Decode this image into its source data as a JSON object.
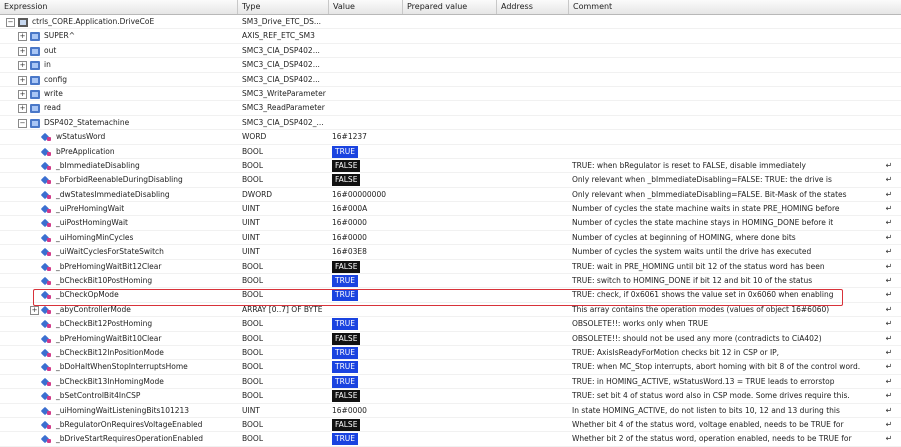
{
  "columns": {
    "expression": "Expression",
    "type": "Type",
    "value": "Value",
    "prepared": "Prepared value",
    "address": "Address",
    "comment": "Comment"
  },
  "rows": [
    {
      "name": "ctrls_CORE.Application.DriveCoE",
      "type": "SM3_Drive_ETC_DS...",
      "value": "",
      "comment": "",
      "depth": 0,
      "expander": "-",
      "icon": "root",
      "enter": false
    },
    {
      "name": "SUPER^",
      "type": "AXIS_REF_ETC_SM3",
      "value": "",
      "comment": "",
      "depth": 1,
      "expander": "+",
      "icon": "obj",
      "enter": false
    },
    {
      "name": "out",
      "type": "SMC3_CIA_DSP402...",
      "value": "",
      "comment": "",
      "depth": 1,
      "expander": "+",
      "icon": "obj",
      "enter": false
    },
    {
      "name": "in",
      "type": "SMC3_CIA_DSP402...",
      "value": "",
      "comment": "",
      "depth": 1,
      "expander": "+",
      "icon": "obj",
      "enter": false
    },
    {
      "name": "config",
      "type": "SMC3_CIA_DSP402...",
      "value": "",
      "comment": "",
      "depth": 1,
      "expander": "+",
      "icon": "obj",
      "enter": false
    },
    {
      "name": "write",
      "type": "SMC3_WriteParameter",
      "value": "",
      "comment": "",
      "depth": 1,
      "expander": "+",
      "icon": "obj",
      "enter": false
    },
    {
      "name": "read",
      "type": "SMC3_ReadParameter",
      "value": "",
      "comment": "",
      "depth": 1,
      "expander": "+",
      "icon": "obj",
      "enter": false
    },
    {
      "name": "DSP402_Statemachine",
      "type": "SMC3_CIA_DSP402_...",
      "value": "",
      "comment": "",
      "depth": 1,
      "expander": "-",
      "icon": "obj",
      "enter": false
    },
    {
      "name": "wStatusWord",
      "type": "WORD",
      "value": "16#1237",
      "comment": "",
      "depth": 2,
      "expander": "",
      "icon": "var",
      "enter": false
    },
    {
      "name": "bPreApplication",
      "type": "BOOL",
      "value": "TRUE",
      "comment": "",
      "depth": 2,
      "expander": "",
      "icon": "var",
      "enter": false
    },
    {
      "name": "_bImmediateDisabling",
      "type": "BOOL",
      "value": "FALSE",
      "comment": "TRUE: when bRegulator is reset to FALSE, disable immediately",
      "depth": 2,
      "expander": "",
      "icon": "var",
      "enter": true
    },
    {
      "name": "_bForbidReenableDuringDisabling",
      "type": "BOOL",
      "value": "FALSE",
      "comment": "Only relevant when _bImmediateDisabling=FALSE: TRUE: the drive is",
      "depth": 2,
      "expander": "",
      "icon": "var",
      "enter": true
    },
    {
      "name": "_dwStatesImmediateDisabling",
      "type": "DWORD",
      "value": "16#00000000",
      "comment": "Only relevant when _bImmediateDisabling=FALSE. Bit-Mask of the states",
      "depth": 2,
      "expander": "",
      "icon": "var",
      "enter": true
    },
    {
      "name": "_uiPreHomingWait",
      "type": "UINT",
      "value": "16#000A",
      "comment": "Number of cycles the state machine waits in state PRE_HOMING before",
      "depth": 2,
      "expander": "",
      "icon": "var",
      "enter": true
    },
    {
      "name": "_uiPostHomingWait",
      "type": "UINT",
      "value": "16#0000",
      "comment": "Number of cycles the state machine stays in HOMING_DONE before it",
      "depth": 2,
      "expander": "",
      "icon": "var",
      "enter": true
    },
    {
      "name": "_uiHomingMinCycles",
      "type": "UINT",
      "value": "16#0000",
      "comment": "Number of cycles at beginning of HOMING, where done bits",
      "depth": 2,
      "expander": "",
      "icon": "var",
      "enter": true
    },
    {
      "name": "_uiWaitCyclesForStateSwitch",
      "type": "UINT",
      "value": "16#03E8",
      "comment": "Number of cycles the system waits until the drive has executed",
      "depth": 2,
      "expander": "",
      "icon": "var",
      "enter": true
    },
    {
      "name": "_bPreHomingWaitBit12Clear",
      "type": "BOOL",
      "value": "FALSE",
      "comment": "TRUE: wait in PRE_HOMING until bit 12 of the status word has been",
      "depth": 2,
      "expander": "",
      "icon": "var",
      "enter": true
    },
    {
      "name": "_bCheckBit10PostHoming",
      "type": "BOOL",
      "value": "TRUE",
      "comment": "TRUE: switch to HOMING_DONE if bit 12 and bit 10 of the status",
      "depth": 2,
      "expander": "",
      "icon": "var",
      "enter": true
    },
    {
      "name": "_bCheckOpMode",
      "type": "BOOL",
      "value": "TRUE",
      "comment": "TRUE: check, if 0x6061 shows the value set in 0x6060 when enabling",
      "depth": 2,
      "expander": "",
      "icon": "var",
      "enter": true
    },
    {
      "name": "_abyControllerMode",
      "type": "ARRAY [0..7] OF BYTE",
      "value": "",
      "comment": "This array contains the operation modes (values of object 16#6060)",
      "depth": 2,
      "expander": "+",
      "icon": "var",
      "enter": true
    },
    {
      "name": "_bCheckBit12PostHoming",
      "type": "BOOL",
      "value": "TRUE",
      "comment": "OBSOLETE!!: works only when TRUE",
      "depth": 2,
      "expander": "",
      "icon": "var",
      "enter": true
    },
    {
      "name": "_bPreHomingWaitBit10Clear",
      "type": "BOOL",
      "value": "FALSE",
      "comment": "OBSOLETE!!: should not be used any more (contradicts to CiA402)",
      "depth": 2,
      "expander": "",
      "icon": "var",
      "enter": true
    },
    {
      "name": "_bCheckBit12InPositionMode",
      "type": "BOOL",
      "value": "TRUE",
      "comment": "TRUE: AxisIsReadyForMotion checks bit 12 in CSP or IP,",
      "depth": 2,
      "expander": "",
      "icon": "var",
      "enter": true
    },
    {
      "name": "_bDoHaltWhenStopInterruptsHome",
      "type": "BOOL",
      "value": "TRUE",
      "comment": "TRUE: when MC_Stop interrupts, abort homing with bit 8 of the control word.",
      "depth": 2,
      "expander": "",
      "icon": "var",
      "enter": true
    },
    {
      "name": "_bCheckBit13InHomingMode",
      "type": "BOOL",
      "value": "TRUE",
      "comment": "TRUE: in HOMING_ACTIVE, wStatusWord.13 = TRUE leads to errorstop",
      "depth": 2,
      "expander": "",
      "icon": "var",
      "enter": true
    },
    {
      "name": "_bSetControlBit4InCSP",
      "type": "BOOL",
      "value": "FALSE",
      "comment": "TRUE: set bit 4 of status word also in CSP mode. Some drives require this.",
      "depth": 2,
      "expander": "",
      "icon": "var",
      "enter": true
    },
    {
      "name": "_uiHomingWaitListeningBits101213",
      "type": "UINT",
      "value": "16#0000",
      "comment": "In state HOMING_ACTIVE, do not listen to bits 10, 12 and 13 during this",
      "depth": 2,
      "expander": "",
      "icon": "var",
      "enter": true
    },
    {
      "name": "_bRegulatorOnRequiresVoltageEnabled",
      "type": "BOOL",
      "value": "FALSE",
      "comment": "Whether bit 4 of the status word, voltage enabled, needs to be TRUE for",
      "depth": 2,
      "expander": "",
      "icon": "var",
      "enter": true
    },
    {
      "name": "_bDriveStartRequiresOperationEnabled",
      "type": "BOOL",
      "value": "TRUE",
      "comment": "Whether bit 2 of the status word, operation enabled, needs to be TRUE for",
      "depth": 2,
      "expander": "",
      "icon": "var",
      "enter": true
    }
  ],
  "icons": {
    "enter": "↵",
    "expanded": "−",
    "collapsed": "+"
  },
  "colors": {
    "true_badge": "#1a43e0",
    "false_badge": "#111111",
    "highlight": "#d8323a"
  }
}
